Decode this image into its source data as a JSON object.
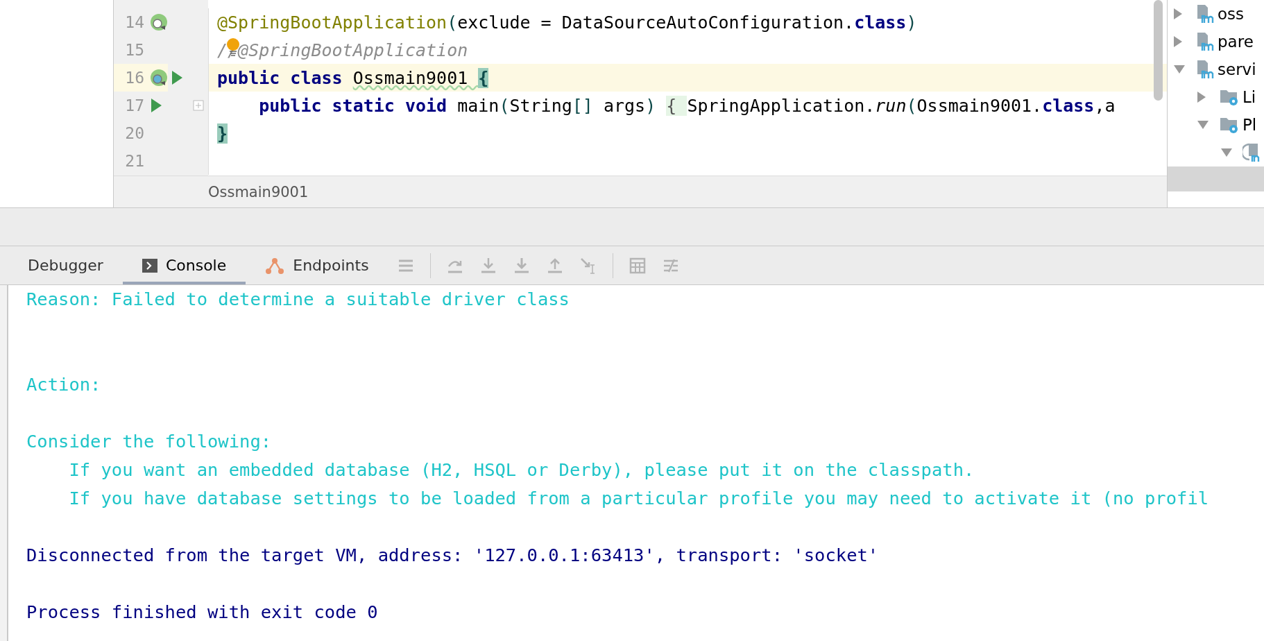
{
  "editor": {
    "lines": [
      {
        "number": "14",
        "current": false,
        "runnable": false,
        "tokens": [
          {
            "text": "@SpringBootApplication",
            "kind": "annotation"
          },
          {
            "text": "(",
            "kind": "paren"
          },
          {
            "text": "exclude = DataSourceAutoConfiguration.",
            "kind": "plain"
          },
          {
            "text": "class",
            "kind": "keyword"
          },
          {
            "text": ")",
            "kind": "paren"
          }
        ]
      },
      {
        "number": "15",
        "current": false,
        "runnable": false,
        "tokens": [
          {
            "text": "//@SpringBootApplication",
            "kind": "comment"
          }
        ]
      },
      {
        "number": "16",
        "current": true,
        "runnable": true,
        "tokens": [
          {
            "text": "public class ",
            "kind": "keyword"
          },
          {
            "text": "Ossmain9001 ",
            "kind": "warning"
          },
          {
            "text": "{",
            "kind": "brace"
          }
        ]
      },
      {
        "number": "17",
        "current": false,
        "runnable": true,
        "tokens": [
          {
            "text": "    public static void ",
            "kind": "keyword"
          },
          {
            "text": "main",
            "kind": "plain"
          },
          {
            "text": "(",
            "kind": "paren"
          },
          {
            "text": "String",
            "kind": "plain"
          },
          {
            "text": "[]",
            "kind": "paren"
          },
          {
            "text": " args",
            "kind": "plain"
          },
          {
            "text": ") ",
            "kind": "paren"
          },
          {
            "text": "{ ",
            "kind": "fold"
          },
          {
            "text": "SpringApplication.",
            "kind": "plain"
          },
          {
            "text": "run",
            "kind": "method"
          },
          {
            "text": "(",
            "kind": "paren"
          },
          {
            "text": "Ossmain9001.",
            "kind": "plain"
          },
          {
            "text": "class",
            "kind": "keyword"
          },
          {
            "text": ",a",
            "kind": "plain"
          }
        ]
      },
      {
        "number": "20",
        "current": false,
        "runnable": false,
        "tokens": [
          {
            "text": "}",
            "kind": "brace"
          }
        ]
      },
      {
        "number": "21",
        "current": false,
        "runnable": false
      }
    ],
    "breadcrumb": "Ossmain9001"
  },
  "project_tree": [
    {
      "label": "oss",
      "kind": "module",
      "expanded": false
    },
    {
      "label": "pare",
      "kind": "module",
      "expanded": false
    },
    {
      "label": "servi",
      "kind": "module",
      "expanded": true,
      "children": [
        {
          "label": "Li",
          "kind": "config-folder",
          "expanded": false
        },
        {
          "label": "Pl",
          "kind": "config-folder",
          "expanded": true,
          "children": [
            {
              "kind": "module-link",
              "expanded": true
            }
          ]
        }
      ]
    }
  ],
  "tool_window": {
    "tabs": [
      {
        "label": "Debugger",
        "kind": "plain",
        "selected": false
      },
      {
        "label": "Console",
        "kind": "console",
        "selected": true
      },
      {
        "label": "Endpoints",
        "kind": "endpoints",
        "selected": false
      }
    ]
  },
  "console": {
    "lines": [
      {
        "kind": "error",
        "text": "Reason: Failed to determine a suitable driver class"
      },
      {
        "kind": "blank"
      },
      {
        "kind": "blank"
      },
      {
        "kind": "error",
        "text": "Action:"
      },
      {
        "kind": "blank"
      },
      {
        "kind": "error",
        "text": "Consider the following:"
      },
      {
        "kind": "error",
        "text": "    If you want an embedded database (H2, HSQL or Derby), please put it on the classpath."
      },
      {
        "kind": "error",
        "text": "    If you have database settings to be loaded from a particular profile you may need to activate it (no profil"
      },
      {
        "kind": "blank"
      },
      {
        "kind": "info",
        "text": "Disconnected from the target VM, address: '127.0.0.1:63413', transport: 'socket'"
      },
      {
        "kind": "blank"
      },
      {
        "kind": "info",
        "text": "Process finished with exit code 0"
      }
    ]
  }
}
